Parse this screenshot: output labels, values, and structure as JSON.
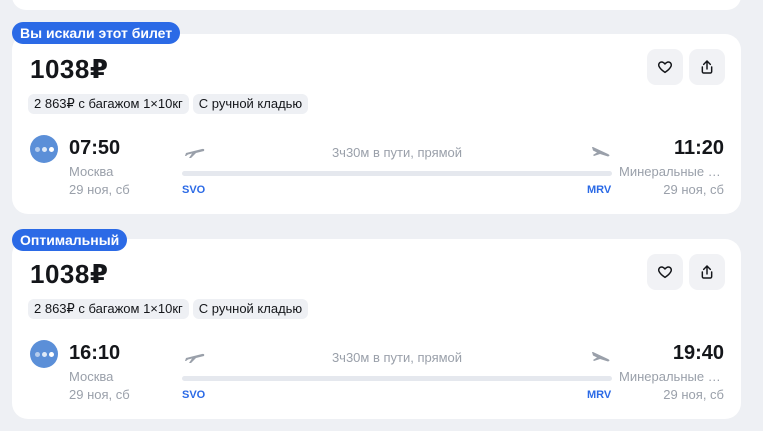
{
  "colors": {
    "accent": "#2b6ae6",
    "background": "#eef0f4",
    "card": "#ffffff",
    "muted_text": "#9aa0aa",
    "airline_logo": "#5b8fd8"
  },
  "icons": {
    "favorite": "heart-icon",
    "share": "share-icon",
    "departure": "plane-takeoff-icon",
    "arrival": "plane-landing-icon",
    "airline": "airline-logo-icon"
  },
  "tickets": [
    {
      "badge": "Вы искали этот билет",
      "price": "1038₽",
      "options": [
        "2 863₽ с багажом 1×10кг",
        "С ручной кладью"
      ],
      "departure": {
        "time": "07:50",
        "city": "Москва",
        "date": "29 ноя, сб",
        "iata": "SVO"
      },
      "arrival": {
        "time": "11:20",
        "city": "Минеральные Воды",
        "date": "29 ноя, сб",
        "iata": "MRV"
      },
      "duration": "3ч30м в пути, прямой"
    },
    {
      "badge": "Оптимальный",
      "price": "1038₽",
      "options": [
        "2 863₽ с багажом 1×10кг",
        "С ручной кладью"
      ],
      "departure": {
        "time": "16:10",
        "city": "Москва",
        "date": "29 ноя, сб",
        "iata": "SVO"
      },
      "arrival": {
        "time": "19:40",
        "city": "Минеральные Воды",
        "date": "29 ноя, сб",
        "iata": "MRV"
      },
      "duration": "3ч30м в пути, прямой"
    }
  ]
}
